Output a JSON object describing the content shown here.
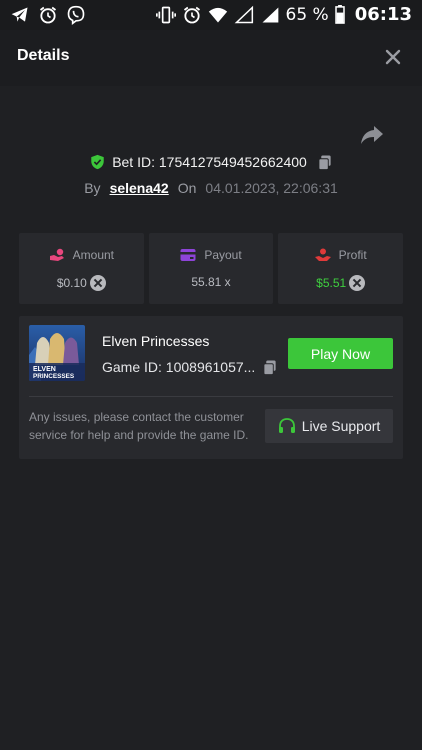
{
  "status_bar": {
    "battery": "65 %",
    "time": "06:13"
  },
  "header": {
    "title": "Details"
  },
  "bet": {
    "id_text": "Bet ID: 1754127549452662400",
    "by_label": "By",
    "username": "selena42",
    "on_label": "On",
    "date": "04.01.2023, 22:06:31"
  },
  "stats": {
    "amount": {
      "label": "Amount",
      "value": "$0.10"
    },
    "payout": {
      "label": "Payout",
      "value": "55.81 x"
    },
    "profit": {
      "label": "Profit",
      "value": "$5.51"
    }
  },
  "game": {
    "name": "Elven Princesses",
    "id_text": "Game ID: 1008961057...",
    "thumb_line1": "ELVEN",
    "thumb_line2": "PRINCESSES",
    "play_label": "Play Now",
    "issue_text": "Any issues, please contact the customer service for help and provide the game ID.",
    "support_label": "Live Support"
  },
  "colors": {
    "accent_green": "#3cc63a",
    "profit_green": "#3fcf3f",
    "background": "#1f2023",
    "card": "#28292d"
  }
}
